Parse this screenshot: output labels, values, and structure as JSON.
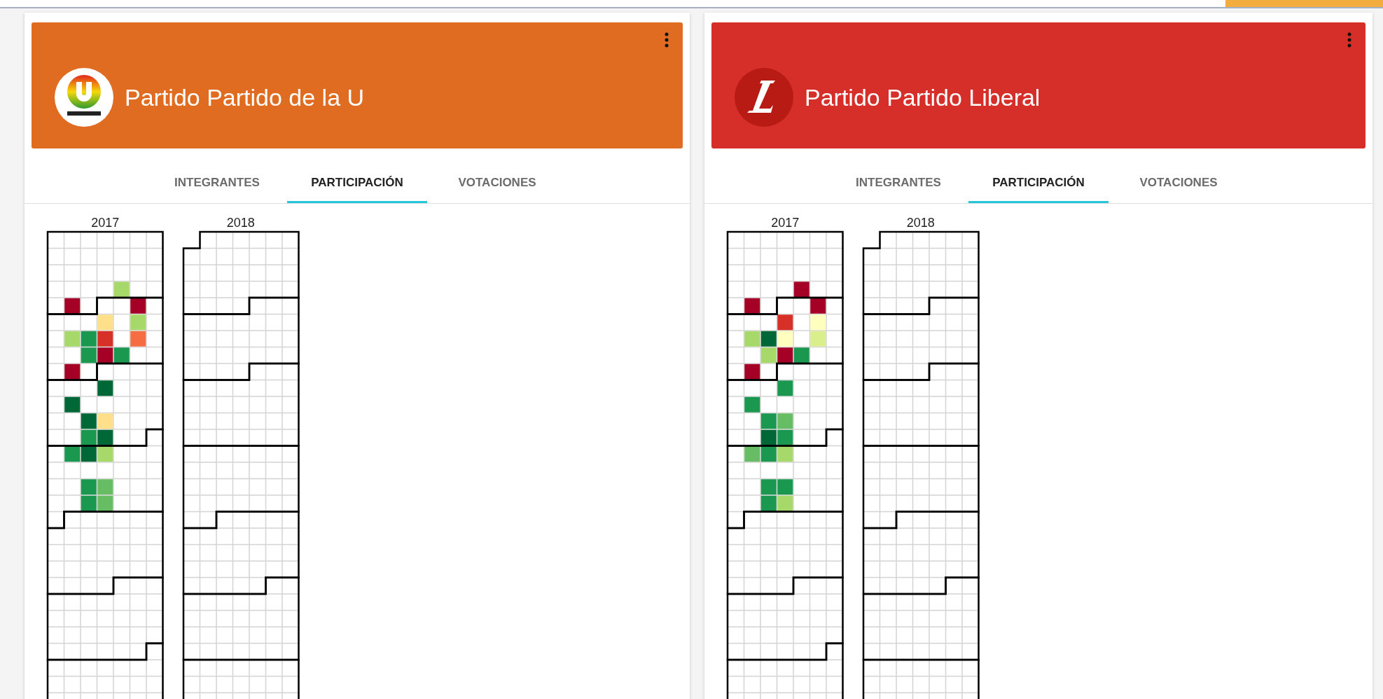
{
  "cards": [
    {
      "title": "Partido Partido de la U",
      "color": "#e06c21",
      "kind": "tricolor",
      "tabs": [
        {
          "label": "INTEGRANTES",
          "selected": false
        },
        {
          "label": "PARTICIPACIÓN",
          "selected": true
        },
        {
          "label": "VOTACIONES",
          "selected": false
        }
      ],
      "calendars": [
        {
          "year": "2017",
          "days": [
            {
              "kind": "blank"
            },
            {
              "kind": "blank"
            },
            {
              "kind": "blank"
            },
            {
              "kind": "blank"
            },
            {
              "kind": "blank"
            },
            {
              "kind": "blank"
            },
            {
              "kind": "blank"
            },
            {
              "kind": "blank"
            },
            {
              "kind": "blank"
            },
            {
              "kind": "blank"
            },
            {
              "kind": "blank"
            },
            {
              "kind": "blank"
            },
            {
              "kind": "blank"
            },
            {
              "kind": "blank"
            },
            {
              "kind": "blank"
            },
            {
              "kind": "blank"
            },
            {
              "kind": "blank"
            },
            {
              "kind": "blank"
            },
            {
              "kind": "blank"
            },
            {
              "kind": "blank"
            },
            {
              "kind": "blank"
            },
            {
              "kind": "blank"
            },
            {
              "kind": "blank"
            },
            {
              "kind": "blank"
            },
            {
              "kind": "blank"
            },
            {
              "kind": "filled",
              "color": "#a6d96a"
            },
            {
              "kind": "blank"
            },
            {
              "kind": "blank"
            },
            {
              "kind": "blank"
            },
            {
              "kind": "filled",
              "color": "#a50026"
            },
            {
              "kind": "blank"
            },
            {
              "kind": "blank"
            },
            {
              "kind": "blank"
            },
            {
              "kind": "filled",
              "color": "#a50026"
            },
            {
              "kind": "blank"
            },
            {
              "kind": "blank"
            },
            {
              "kind": "blank"
            },
            {
              "kind": "blank"
            },
            {
              "kind": "filled",
              "color": "#fee08b"
            },
            {
              "kind": "blank"
            },
            {
              "kind": "filled",
              "color": "#a6d96a"
            },
            {
              "kind": "blank"
            },
            {
              "kind": "blank"
            },
            {
              "kind": "filled",
              "color": "#a6d96a"
            },
            {
              "kind": "filled",
              "color": "#1a9850"
            },
            {
              "kind": "filled",
              "color": "#d73027"
            },
            {
              "kind": "blank"
            },
            {
              "kind": "filled",
              "color": "#f46d43"
            },
            {
              "kind": "blank"
            },
            {
              "kind": "blank"
            },
            {
              "kind": "blank"
            },
            {
              "kind": "filled",
              "color": "#1a9850"
            },
            {
              "kind": "filled",
              "color": "#a50026"
            },
            {
              "kind": "filled",
              "color": "#1a9850"
            },
            {
              "kind": "blank"
            },
            {
              "kind": "blank"
            },
            {
              "kind": "blank"
            },
            {
              "kind": "filled",
              "color": "#a50026"
            },
            {
              "kind": "blank"
            },
            {
              "kind": "blank"
            },
            {
              "kind": "blank"
            },
            {
              "kind": "blank"
            },
            {
              "kind": "blank"
            },
            {
              "kind": "blank"
            },
            {
              "kind": "blank"
            },
            {
              "kind": "blank"
            },
            {
              "kind": "filled",
              "color": "#006837"
            },
            {
              "kind": "blank"
            },
            {
              "kind": "blank"
            },
            {
              "kind": "blank"
            },
            {
              "kind": "blank"
            },
            {
              "kind": "filled",
              "color": "#006837"
            },
            {
              "kind": "blank"
            },
            {
              "kind": "blank"
            },
            {
              "kind": "blank"
            },
            {
              "kind": "blank"
            },
            {
              "kind": "blank"
            },
            {
              "kind": "blank"
            },
            {
              "kind": "blank"
            },
            {
              "kind": "filled",
              "color": "#006837"
            },
            {
              "kind": "filled",
              "color": "#fee08b"
            },
            {
              "kind": "blank"
            },
            {
              "kind": "blank"
            },
            {
              "kind": "blank"
            },
            {
              "kind": "blank"
            },
            {
              "kind": "blank"
            },
            {
              "kind": "filled",
              "color": "#1a9850"
            },
            {
              "kind": "filled",
              "color": "#006837"
            },
            {
              "kind": "blank"
            },
            {
              "kind": "blank"
            },
            {
              "kind": "blank"
            },
            {
              "kind": "blank"
            },
            {
              "kind": "filled",
              "color": "#1a9850"
            },
            {
              "kind": "filled",
              "color": "#006837"
            },
            {
              "kind": "filled",
              "color": "#a6d96a"
            },
            {
              "kind": "blank"
            },
            {
              "kind": "blank"
            },
            {
              "kind": "blank"
            },
            {
              "kind": "blank"
            },
            {
              "kind": "blank"
            },
            {
              "kind": "blank"
            },
            {
              "kind": "blank"
            },
            {
              "kind": "blank"
            },
            {
              "kind": "blank"
            },
            {
              "kind": "blank"
            },
            {
              "kind": "blank"
            },
            {
              "kind": "blank"
            },
            {
              "kind": "filled",
              "color": "#1a9850"
            },
            {
              "kind": "filled",
              "color": "#66bd63"
            },
            {
              "kind": "blank"
            },
            {
              "kind": "blank"
            },
            {
              "kind": "blank"
            },
            {
              "kind": "blank"
            },
            {
              "kind": "blank"
            },
            {
              "kind": "filled",
              "color": "#1a9850"
            },
            {
              "kind": "filled",
              "color": "#66bd63"
            }
          ]
        },
        {
          "year": "2018"
        }
      ]
    },
    {
      "title": "Partido Partido Liberal",
      "color": "#d62f2a",
      "kind": "red",
      "tabs": [
        {
          "label": "INTEGRANTES",
          "selected": false
        },
        {
          "label": "PARTICIPACIÓN",
          "selected": true
        },
        {
          "label": "VOTACIONES",
          "selected": false
        }
      ],
      "calendars": [
        {
          "year": "2017",
          "days": [
            {
              "kind": "blank"
            },
            {
              "kind": "blank"
            },
            {
              "kind": "blank"
            },
            {
              "kind": "blank"
            },
            {
              "kind": "blank"
            },
            {
              "kind": "blank"
            },
            {
              "kind": "blank"
            },
            {
              "kind": "blank"
            },
            {
              "kind": "blank"
            },
            {
              "kind": "blank"
            },
            {
              "kind": "blank"
            },
            {
              "kind": "blank"
            },
            {
              "kind": "blank"
            },
            {
              "kind": "blank"
            },
            {
              "kind": "blank"
            },
            {
              "kind": "blank"
            },
            {
              "kind": "blank"
            },
            {
              "kind": "blank"
            },
            {
              "kind": "blank"
            },
            {
              "kind": "blank"
            },
            {
              "kind": "blank"
            },
            {
              "kind": "blank"
            },
            {
              "kind": "blank"
            },
            {
              "kind": "blank"
            },
            {
              "kind": "blank"
            },
            {
              "kind": "filled",
              "color": "#a50026"
            },
            {
              "kind": "blank"
            },
            {
              "kind": "blank"
            },
            {
              "kind": "blank"
            },
            {
              "kind": "filled",
              "color": "#a50026"
            },
            {
              "kind": "blank"
            },
            {
              "kind": "blank"
            },
            {
              "kind": "blank"
            },
            {
              "kind": "filled",
              "color": "#a50026"
            },
            {
              "kind": "blank"
            },
            {
              "kind": "blank"
            },
            {
              "kind": "blank"
            },
            {
              "kind": "blank"
            },
            {
              "kind": "filled",
              "color": "#d73027"
            },
            {
              "kind": "blank"
            },
            {
              "kind": "filled",
              "color": "#ffffbf"
            },
            {
              "kind": "blank"
            },
            {
              "kind": "blank"
            },
            {
              "kind": "filled",
              "color": "#a6d96a"
            },
            {
              "kind": "filled",
              "color": "#006837"
            },
            {
              "kind": "filled",
              "color": "#ffffbf"
            },
            {
              "kind": "blank"
            },
            {
              "kind": "filled",
              "color": "#d9ef8b"
            },
            {
              "kind": "blank"
            },
            {
              "kind": "blank"
            },
            {
              "kind": "blank"
            },
            {
              "kind": "filled",
              "color": "#a6d96a"
            },
            {
              "kind": "filled",
              "color": "#a50026"
            },
            {
              "kind": "filled",
              "color": "#1a9850"
            },
            {
              "kind": "blank"
            },
            {
              "kind": "blank"
            },
            {
              "kind": "blank"
            },
            {
              "kind": "filled",
              "color": "#a50026"
            },
            {
              "kind": "blank"
            },
            {
              "kind": "blank"
            },
            {
              "kind": "blank"
            },
            {
              "kind": "blank"
            },
            {
              "kind": "blank"
            },
            {
              "kind": "blank"
            },
            {
              "kind": "blank"
            },
            {
              "kind": "blank"
            },
            {
              "kind": "filled",
              "color": "#1a9850"
            },
            {
              "kind": "blank"
            },
            {
              "kind": "blank"
            },
            {
              "kind": "blank"
            },
            {
              "kind": "blank"
            },
            {
              "kind": "filled",
              "color": "#1a9850"
            },
            {
              "kind": "blank"
            },
            {
              "kind": "blank"
            },
            {
              "kind": "blank"
            },
            {
              "kind": "blank"
            },
            {
              "kind": "blank"
            },
            {
              "kind": "blank"
            },
            {
              "kind": "blank"
            },
            {
              "kind": "filled",
              "color": "#1a9850"
            },
            {
              "kind": "filled",
              "color": "#66bd63"
            },
            {
              "kind": "blank"
            },
            {
              "kind": "blank"
            },
            {
              "kind": "blank"
            },
            {
              "kind": "blank"
            },
            {
              "kind": "blank"
            },
            {
              "kind": "filled",
              "color": "#006837"
            },
            {
              "kind": "filled",
              "color": "#1a9850"
            },
            {
              "kind": "blank"
            },
            {
              "kind": "blank"
            },
            {
              "kind": "blank"
            },
            {
              "kind": "blank"
            },
            {
              "kind": "filled",
              "color": "#66bd63"
            },
            {
              "kind": "filled",
              "color": "#1a9850"
            },
            {
              "kind": "filled",
              "color": "#a6d96a"
            },
            {
              "kind": "blank"
            },
            {
              "kind": "blank"
            },
            {
              "kind": "blank"
            },
            {
              "kind": "blank"
            },
            {
              "kind": "blank"
            },
            {
              "kind": "blank"
            },
            {
              "kind": "blank"
            },
            {
              "kind": "blank"
            },
            {
              "kind": "blank"
            },
            {
              "kind": "blank"
            },
            {
              "kind": "blank"
            },
            {
              "kind": "blank"
            },
            {
              "kind": "filled",
              "color": "#1a9850"
            },
            {
              "kind": "filled",
              "color": "#1a9850"
            },
            {
              "kind": "blank"
            },
            {
              "kind": "blank"
            },
            {
              "kind": "blank"
            },
            {
              "kind": "blank"
            },
            {
              "kind": "blank"
            },
            {
              "kind": "filled",
              "color": "#1a9850"
            },
            {
              "kind": "filled",
              "color": "#a6d96a"
            }
          ]
        },
        {
          "year": "2018"
        }
      ]
    }
  ]
}
